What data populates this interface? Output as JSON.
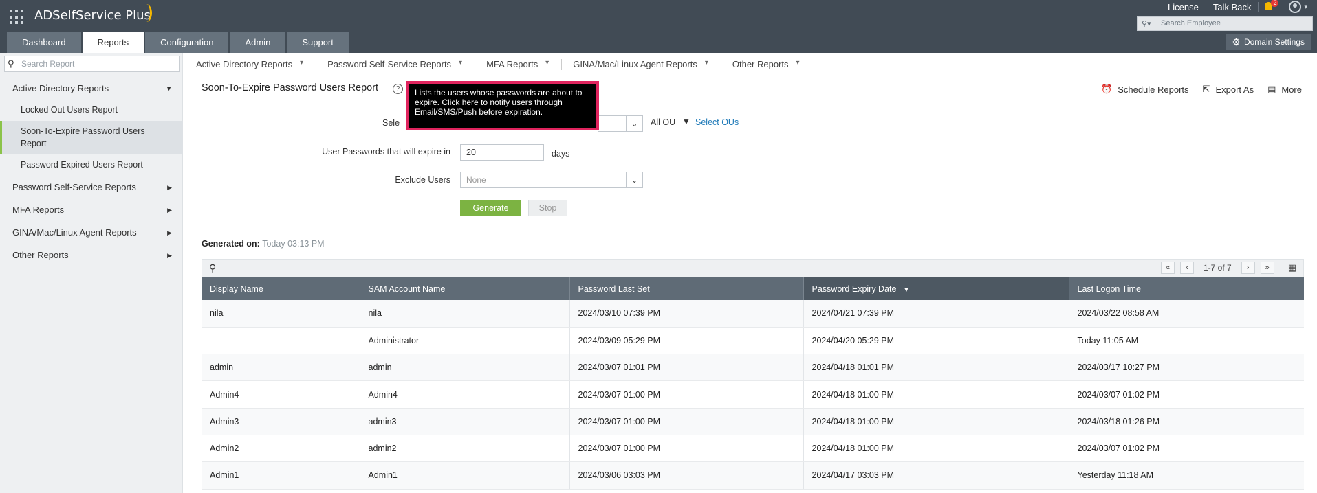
{
  "header": {
    "app_name": "ADSelfService Plus",
    "links": [
      "License",
      "Talk Back"
    ],
    "notification_count": "2",
    "search_placeholder": "Search Employee",
    "domain_settings": "Domain Settings",
    "tabs": [
      {
        "label": "Dashboard",
        "active": false
      },
      {
        "label": "Reports",
        "active": true
      },
      {
        "label": "Configuration",
        "active": false
      },
      {
        "label": "Admin",
        "active": false
      },
      {
        "label": "Support",
        "active": false
      }
    ]
  },
  "sidebar": {
    "search_placeholder": "Search Report",
    "items": [
      {
        "label": "Active Directory Reports",
        "level": 1,
        "expanded": true
      },
      {
        "label": "Locked Out Users Report",
        "level": 2
      },
      {
        "label": "Soon-To-Expire Password Users Report",
        "level": 2,
        "active": true
      },
      {
        "label": "Password Expired Users Report",
        "level": 2
      },
      {
        "label": "Password Self-Service Reports",
        "level": 1
      },
      {
        "label": "MFA Reports",
        "level": 1
      },
      {
        "label": "GINA/Mac/Linux Agent Reports",
        "level": 1
      },
      {
        "label": "Other Reports",
        "level": 1
      }
    ]
  },
  "subnav": [
    "Active Directory Reports",
    "Password Self-Service Reports",
    "MFA Reports",
    "GINA/Mac/Linux Agent Reports",
    "Other Reports"
  ],
  "report": {
    "title": "Soon-To-Expire Password Users Report",
    "tooltip_pre": "Lists the users whose passwords are about to expire. ",
    "tooltip_link": "Click here",
    "tooltip_post": " to notify users through Email/SMS/Push before expiration.",
    "actions": [
      "Schedule Reports",
      "Export As",
      "More"
    ],
    "select_label": "Sele",
    "all_ou": "All OU",
    "select_ous": "Select OUs",
    "expire_label": "User Passwords that will expire in",
    "expire_value": "20",
    "days": "days",
    "exclude_label": "Exclude Users",
    "exclude_placeholder": "None",
    "generate": "Generate",
    "stop": "Stop",
    "generated_on_label": "Generated on:",
    "generated_on_value": "Today 03:13 PM"
  },
  "table": {
    "pager": "1-7 of 7",
    "columns": [
      "Display Name",
      "SAM Account Name",
      "Password Last Set",
      "Password Expiry Date",
      "Last Logon Time"
    ],
    "sorted_column": "Password Expiry Date",
    "rows": [
      [
        "nila",
        "nila",
        "2024/03/10 07:39 PM",
        "2024/04/21 07:39 PM",
        "2024/03/22 08:58 AM"
      ],
      [
        "-",
        "Administrator",
        "2024/03/09 05:29 PM",
        "2024/04/20 05:29 PM",
        "Today 11:05 AM"
      ],
      [
        "admin",
        "admin",
        "2024/03/07 01:01 PM",
        "2024/04/18 01:01 PM",
        "2024/03/17 10:27 PM"
      ],
      [
        "Admin4",
        "Admin4",
        "2024/03/07 01:00 PM",
        "2024/04/18 01:00 PM",
        "2024/03/07 01:02 PM"
      ],
      [
        "Admin3",
        "admin3",
        "2024/03/07 01:00 PM",
        "2024/04/18 01:00 PM",
        "2024/03/18 01:26 PM"
      ],
      [
        "Admin2",
        "admin2",
        "2024/03/07 01:00 PM",
        "2024/04/18 01:00 PM",
        "2024/03/07 01:02 PM"
      ],
      [
        "Admin1",
        "Admin1",
        "2024/03/06 03:03 PM",
        "2024/04/17 03:03 PM",
        "Yesterday 11:18 AM"
      ]
    ]
  }
}
